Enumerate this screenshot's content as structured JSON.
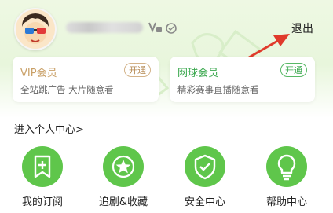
{
  "header": {
    "logout_label": "退出"
  },
  "cards": {
    "vip": {
      "title": "VIP会员",
      "button": "开通",
      "desc": "全站跳广告 大片随意看"
    },
    "sport": {
      "title": "网球会员",
      "button": "开通",
      "desc": "精彩赛事直播随意看"
    }
  },
  "section": {
    "title": "进入个人中心>"
  },
  "functions": [
    {
      "label": "我的订阅",
      "icon": "bookmark-plus-icon"
    },
    {
      "label": "追剧&收藏",
      "icon": "star-icon"
    },
    {
      "label": "安全中心",
      "icon": "shield-check-icon"
    },
    {
      "label": "帮助中心",
      "icon": "lightbulb-icon"
    }
  ],
  "colors": {
    "accent_green": "#5fc64b",
    "vip_gold": "#c9a067",
    "arrow_red": "#e03a2b"
  }
}
